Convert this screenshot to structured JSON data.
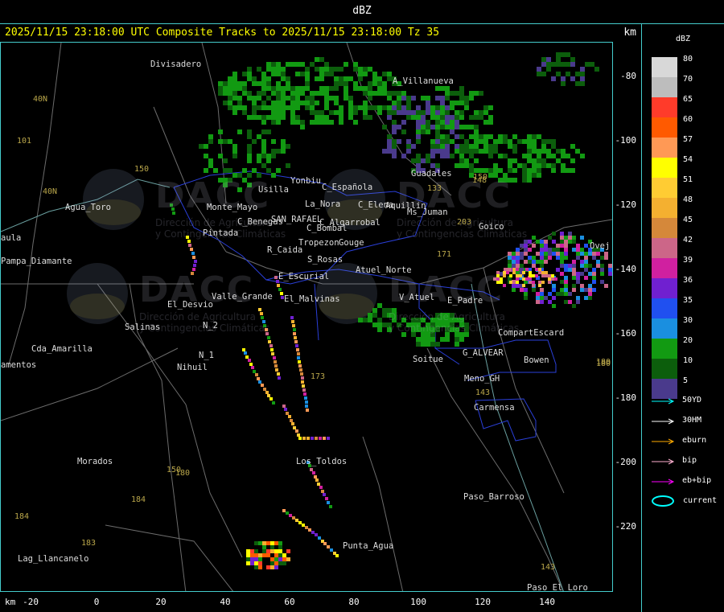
{
  "header": {
    "product": "dBZ"
  },
  "title": {
    "text": "2025/11/15 23:18:00 UTC Composite Tracks to 2025/11/15 23:18:00 Tz 35",
    "unit": "km"
  },
  "x_axis": {
    "unit": "km",
    "ticks": [
      "-20",
      "0",
      "20",
      "40",
      "60",
      "80",
      "100",
      "120",
      "140"
    ]
  },
  "y_axis": {
    "ticks": [
      "-80",
      "-100",
      "-120",
      "-140",
      "-160",
      "-180",
      "-200",
      "-220"
    ]
  },
  "legend": {
    "unit": "dBZ",
    "levels": [
      {
        "label": "80",
        "color": "#d8d8d8"
      },
      {
        "label": "70",
        "color": "#bdbdbd"
      },
      {
        "label": "65",
        "color": "#ff3b2a"
      },
      {
        "label": "60",
        "color": "#ff5a00"
      },
      {
        "label": "57",
        "color": "#ff9955"
      },
      {
        "label": "54",
        "color": "#ffff00"
      },
      {
        "label": "51",
        "color": "#ffcc33"
      },
      {
        "label": "48",
        "color": "#f4b030"
      },
      {
        "label": "45",
        "color": "#d5883a"
      },
      {
        "label": "42",
        "color": "#cc6688"
      },
      {
        "label": "39",
        "color": "#d020a0"
      },
      {
        "label": "36",
        "color": "#7020d0"
      },
      {
        "label": "35",
        "color": "#2050f0"
      },
      {
        "label": "30",
        "color": "#1a8fe0"
      },
      {
        "label": "20",
        "color": "#129a12"
      },
      {
        "label": "10",
        "color": "#0c5e0c"
      },
      {
        "label": "5",
        "color": "#4a3a8c"
      }
    ],
    "tracks": [
      {
        "label": "50YD",
        "color": "#00ffff"
      },
      {
        "label": "30HM",
        "color": "#ffffff"
      },
      {
        "label": "eburn",
        "color": "#ffaa00"
      },
      {
        "label": "bip",
        "color": "#ffb0d0"
      },
      {
        "label": "eb+bip",
        "color": "#ff00ff"
      }
    ],
    "current_label": "current"
  },
  "map": {
    "watermark": {
      "brand": "DACC",
      "line1": "Dirección de Agricultura",
      "line2": "y Contingencias Climáticas"
    },
    "towns": [
      "Divisadero",
      "A_Villanueva",
      "Guadales",
      "Yonbiu",
      "Usilla",
      "C_Española",
      "La_Nora",
      "C_Elena",
      "Aquillin",
      "Ms_Juman",
      "Monte_Mayo",
      "C_Benegas",
      "SAN_RAFAEL",
      "C_Bombal",
      "C_Algarrobal",
      "Pintada",
      "Tropezon",
      "Gouge",
      "Goico",
      "R_Caida",
      "S_Rosas",
      "Atuel_Norte",
      "E_Escurial",
      "Valle_Grande",
      "El_Malvinas",
      "El_Desvio",
      "V_Atuel",
      "E_Padre",
      "CompartEscard",
      "Salinas",
      "N_2",
      "N_1",
      "Nihuil",
      "Soitue",
      "G_ALVEAR",
      "Bowen",
      "Meno_GH",
      "Carmensa",
      "Cda_Amarilla",
      "amentos",
      "aula",
      "Pampa_Diamante",
      "Agua_Toro",
      "Morados",
      "Los_Toldos",
      "Paso_Barroso",
      "Punta_Agua",
      "Lag_Llancanelo",
      "Paso_El_Loro",
      "Ovej"
    ],
    "grid_labels": [
      "40N",
      "101",
      "40N",
      "150",
      "150",
      "180",
      "184",
      "183",
      "184",
      "171",
      "173",
      "180",
      "203",
      "148",
      "150",
      "133",
      "143",
      "143",
      "180"
    ]
  }
}
